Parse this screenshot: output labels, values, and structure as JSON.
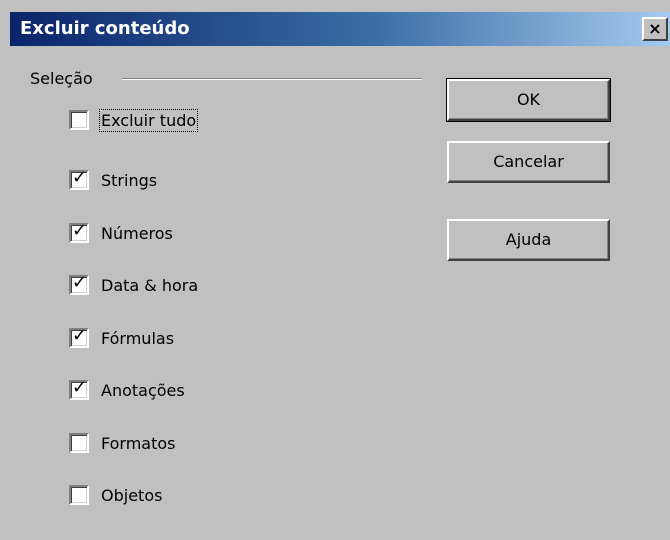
{
  "window": {
    "title": "Excluir conteúdo",
    "close_glyph": "×"
  },
  "group": {
    "label": "Seleção",
    "options": [
      {
        "label": "Excluir tudo",
        "checked": false,
        "focused": true
      },
      {
        "label": "Strings",
        "checked": true
      },
      {
        "label": "Números",
        "checked": true
      },
      {
        "label": "Data & hora",
        "checked": true
      },
      {
        "label": "Fórmulas",
        "checked": true
      },
      {
        "label": "Anotações",
        "checked": true
      },
      {
        "label": "Formatos",
        "checked": false
      },
      {
        "label": "Objetos",
        "checked": false
      }
    ]
  },
  "buttons": {
    "ok": "OK",
    "cancel": "Cancelar",
    "help": "Ajuda"
  },
  "colors": {
    "titlebar_start": "#0a246a",
    "titlebar_end": "#a6caf0",
    "dialog_face": "#c0c0c0"
  }
}
